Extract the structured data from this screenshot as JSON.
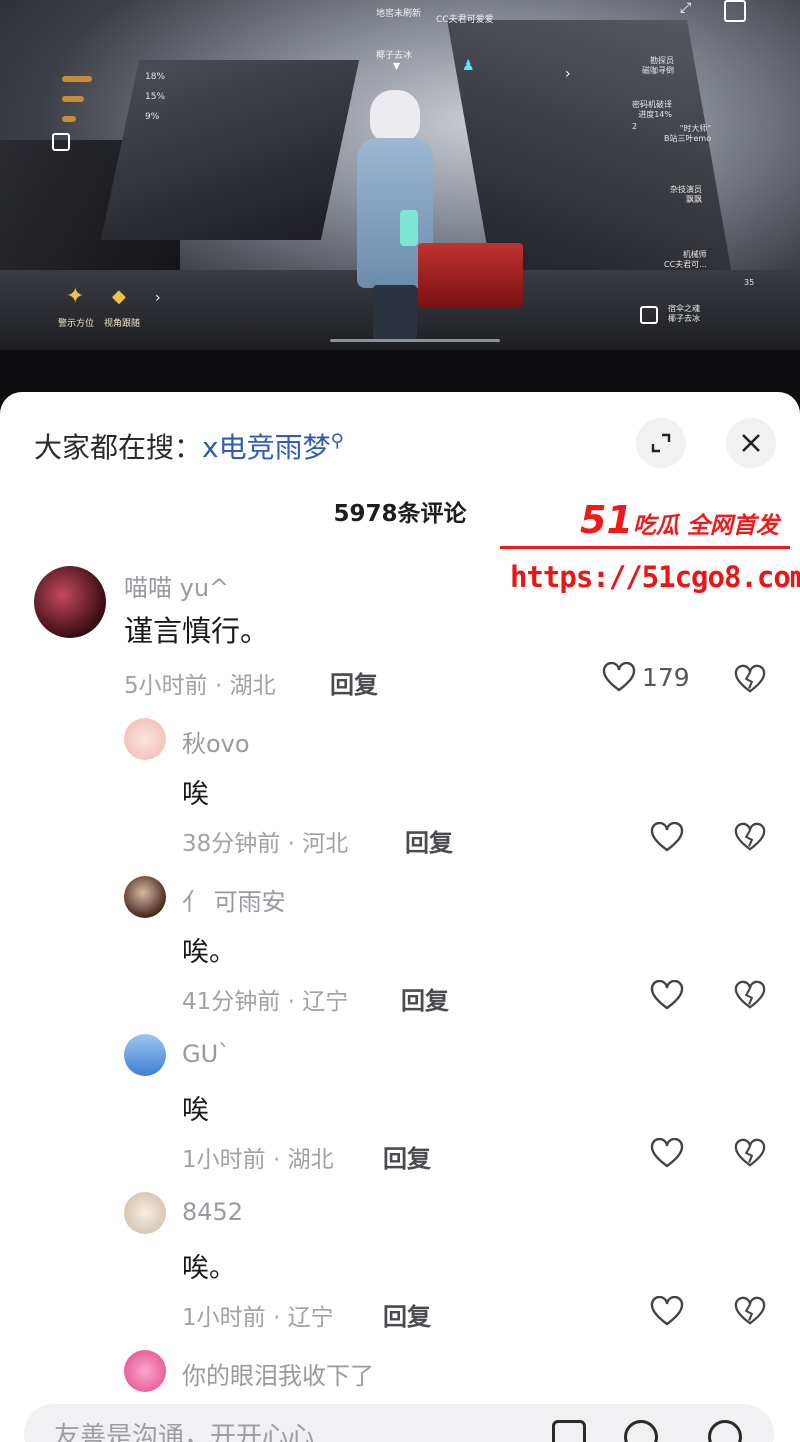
{
  "video": {
    "hud_top_left": [
      "地窖未刷新",
      "CC夫君可爱爱",
      "椰子去冰"
    ],
    "hud_percents": [
      "18%",
      "15%",
      "9%"
    ],
    "hud_right": [
      {
        "name": "勘探员",
        "sub": "磁咖寻倒"
      },
      {
        "name": "密码机破译",
        "sub": "进度14%"
      },
      {
        "name": "\"时大师\"",
        "sub": "B站三叶emo"
      },
      {
        "name": "杂技演员",
        "sub": "飘飘"
      },
      {
        "name": "机械师",
        "sub": "CC夫君可..."
      },
      {
        "name": "宿伞之魂",
        "sub": "椰子去冰"
      }
    ],
    "hud_count_num": "2",
    "hud_num_35": "35",
    "bottom_left_labels": [
      "警示方位",
      "视角跟随"
    ]
  },
  "sheet": {
    "search_prefix": "大家都在搜：",
    "search_term": "x电竞雨梦",
    "comment_count": "5978条评论",
    "watermark": {
      "brand": "51",
      "slogan": "吃瓜 全网首发",
      "url": "https://51cgo8.com"
    },
    "comments": [
      {
        "name": "喵喵 yu^",
        "text": "谨言慎行。",
        "time": "5小时前 · 湖北",
        "reply": "回复",
        "likes": "179",
        "avatar_color": "#6b1a24"
      },
      {
        "name": "秋ovo",
        "text": "唉",
        "time": "38分钟前 · 河北",
        "reply": "回复",
        "likes": "",
        "avatar_color": "#f6cfc9"
      },
      {
        "name": "亻 可雨安",
        "text": "唉。",
        "time": "41分钟前 · 辽宁",
        "reply": "回复",
        "likes": "",
        "avatar_color": "#5a3a2e"
      },
      {
        "name": "GU`",
        "text": "唉",
        "time": "1小时前 · 湖北",
        "reply": "回复",
        "likes": "",
        "avatar_color": "#4a86d6"
      },
      {
        "name": "8452",
        "text": "唉。",
        "time": "1小时前 · 辽宁",
        "reply": "回复",
        "likes": "",
        "avatar_color": "#e8d9c7"
      },
      {
        "name": "你的眼泪我收下了",
        "text": "",
        "time": "",
        "reply": "",
        "likes": "",
        "avatar_color": "#e84a8e"
      }
    ],
    "input_placeholder": "友善是沟通，开开心心"
  }
}
